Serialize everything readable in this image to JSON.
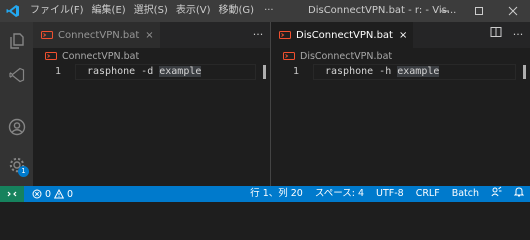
{
  "titlebar": {
    "menu": [
      "ファイル(F)",
      "編集(E)",
      "選択(S)",
      "表示(V)",
      "移動(G)"
    ],
    "more": "···",
    "window_title": "DisConnectVPN.bat - r: - Vis..."
  },
  "activity": {
    "settings_badge": "1"
  },
  "left_group": {
    "tab_label": "ConnectVPN.bat",
    "tab_close": "×",
    "more": "···",
    "breadcrumb": "ConnectVPN.bat",
    "line_number": "1",
    "code_prefix": "rasphone -d ",
    "code_word": "example"
  },
  "right_group": {
    "tab_label": "DisConnectVPN.bat",
    "tab_close": "×",
    "more": "···",
    "breadcrumb": "DisConnectVPN.bat",
    "line_number": "1",
    "code_prefix": "rasphone -h ",
    "code_word": "example"
  },
  "statusbar": {
    "errors": "0",
    "warnings": "0",
    "cursor": "行 1、列 20",
    "indent": "スペース: 4",
    "encoding": "UTF-8",
    "eol": "CRLF",
    "language": "Batch"
  },
  "colors": {
    "accent": "#007acc",
    "remote": "#16825d",
    "bat_icon": "#f1502f"
  }
}
